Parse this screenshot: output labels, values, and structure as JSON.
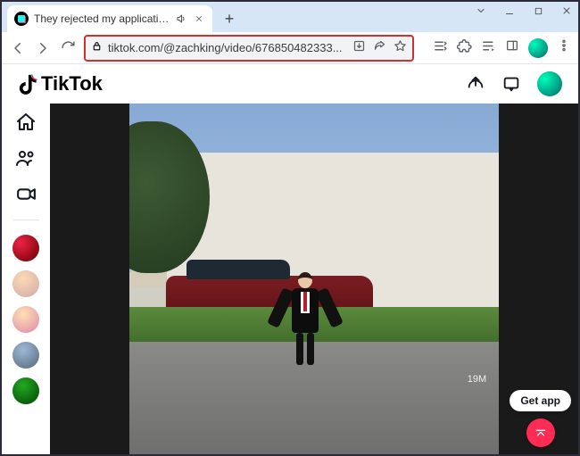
{
  "browser": {
    "tab_title": "They rejected my application",
    "url": "tiktok.com/@zachking/video/676850482333...",
    "nav_icons": {
      "back": "back-icon",
      "forward": "forward-icon",
      "reload": "reload-icon"
    },
    "addr_icons": {
      "lock": "lock-icon",
      "install": "install-app-icon",
      "share": "share-icon",
      "star": "bookmark-star-icon"
    },
    "ext_icons": {
      "reading": "reading-list-icon",
      "puzzle": "extensions-icon",
      "playlist": "playlist-icon",
      "side": "side-panel-icon",
      "profile": "profile-avatar",
      "menu": "kebab-menu-icon"
    }
  },
  "header": {
    "logo_text": "TikTok",
    "icons": {
      "upload": "upload-icon",
      "inbox": "inbox-icon",
      "avatar": "user-avatar"
    }
  },
  "sidebar": {
    "main_icons": {
      "home": "home-icon",
      "following": "following-icon",
      "live": "live-icon"
    },
    "suggested": [
      {
        "name": "suggested-1",
        "bg": "radial-gradient(circle at 30% 30%,#e24,#600)"
      },
      {
        "name": "suggested-2",
        "bg": "radial-gradient(circle at 40% 30%,#ffd9b3,#caa)"
      },
      {
        "name": "suggested-3",
        "bg": "radial-gradient(circle at 40% 30%,#ffe0b3,#d8a)"
      },
      {
        "name": "suggested-4",
        "bg": "radial-gradient(circle at 40% 30%,#9fb9d8,#567)"
      },
      {
        "name": "suggested-5",
        "bg": "radial-gradient(circle at 40% 30%,#2a2,#040)"
      }
    ]
  },
  "video": {
    "get_app_label": "Get app",
    "like_count": "19M"
  }
}
